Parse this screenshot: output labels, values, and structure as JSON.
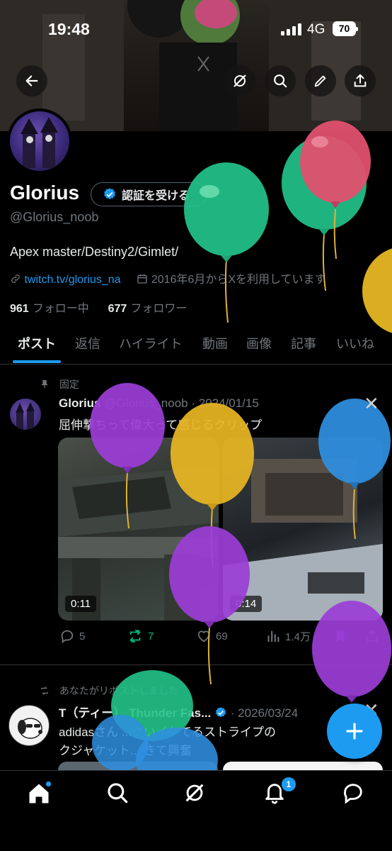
{
  "status_bar": {
    "time": "19:48",
    "network": "4G",
    "battery": "70"
  },
  "profile": {
    "name": "Glorius",
    "verify_label": "認証を受ける",
    "handle": "@Glorius_noob",
    "bio": "Apex master/Destiny2/Gimlet/",
    "link": "twitch.tv/glorius_na",
    "joined": "2016年6月からXを利用しています",
    "following_count": "961",
    "following_label": "フォロー中",
    "followers_count": "677",
    "followers_label": "フォロワー"
  },
  "tabs": [
    {
      "label": "ポスト",
      "active": true
    },
    {
      "label": "返信"
    },
    {
      "label": "ハイライト"
    },
    {
      "label": "動画"
    },
    {
      "label": "画像"
    },
    {
      "label": "記事"
    },
    {
      "label": "いいね"
    }
  ],
  "pinned_post": {
    "pinned_label": "固定",
    "author": "Glorius",
    "meta": "@Glorius_noob · 2024/01/15",
    "text": "屈伸撃ちって偉大って感じるクリップ",
    "media": [
      {
        "duration": "0:11"
      },
      {
        "duration": "0:14"
      }
    ],
    "actions": {
      "replies": "5",
      "reposts": "7",
      "likes": "69",
      "views": "1.4万"
    }
  },
  "repost": {
    "reposted_label": "あなたがリポストしました",
    "author": "T（ティー） Thunder Fas...",
    "meta": "· 2026/03/24",
    "text_line1": "adidasさん ...グいイケてるストライプの",
    "text_line2": "クジャケット... きて興奮"
  },
  "nav": {
    "notifications_badge": "1"
  },
  "icons": {
    "back": "back-arrow-icon",
    "grok": "grok-icon",
    "search": "search-icon",
    "edit": "pencil-icon",
    "share": "share-icon",
    "pin": "pin-icon",
    "verified": "verified-badge-icon"
  },
  "colors": {
    "accent": "#1d9bf0",
    "repost_active": "#00ba7c",
    "background": "#000000"
  }
}
